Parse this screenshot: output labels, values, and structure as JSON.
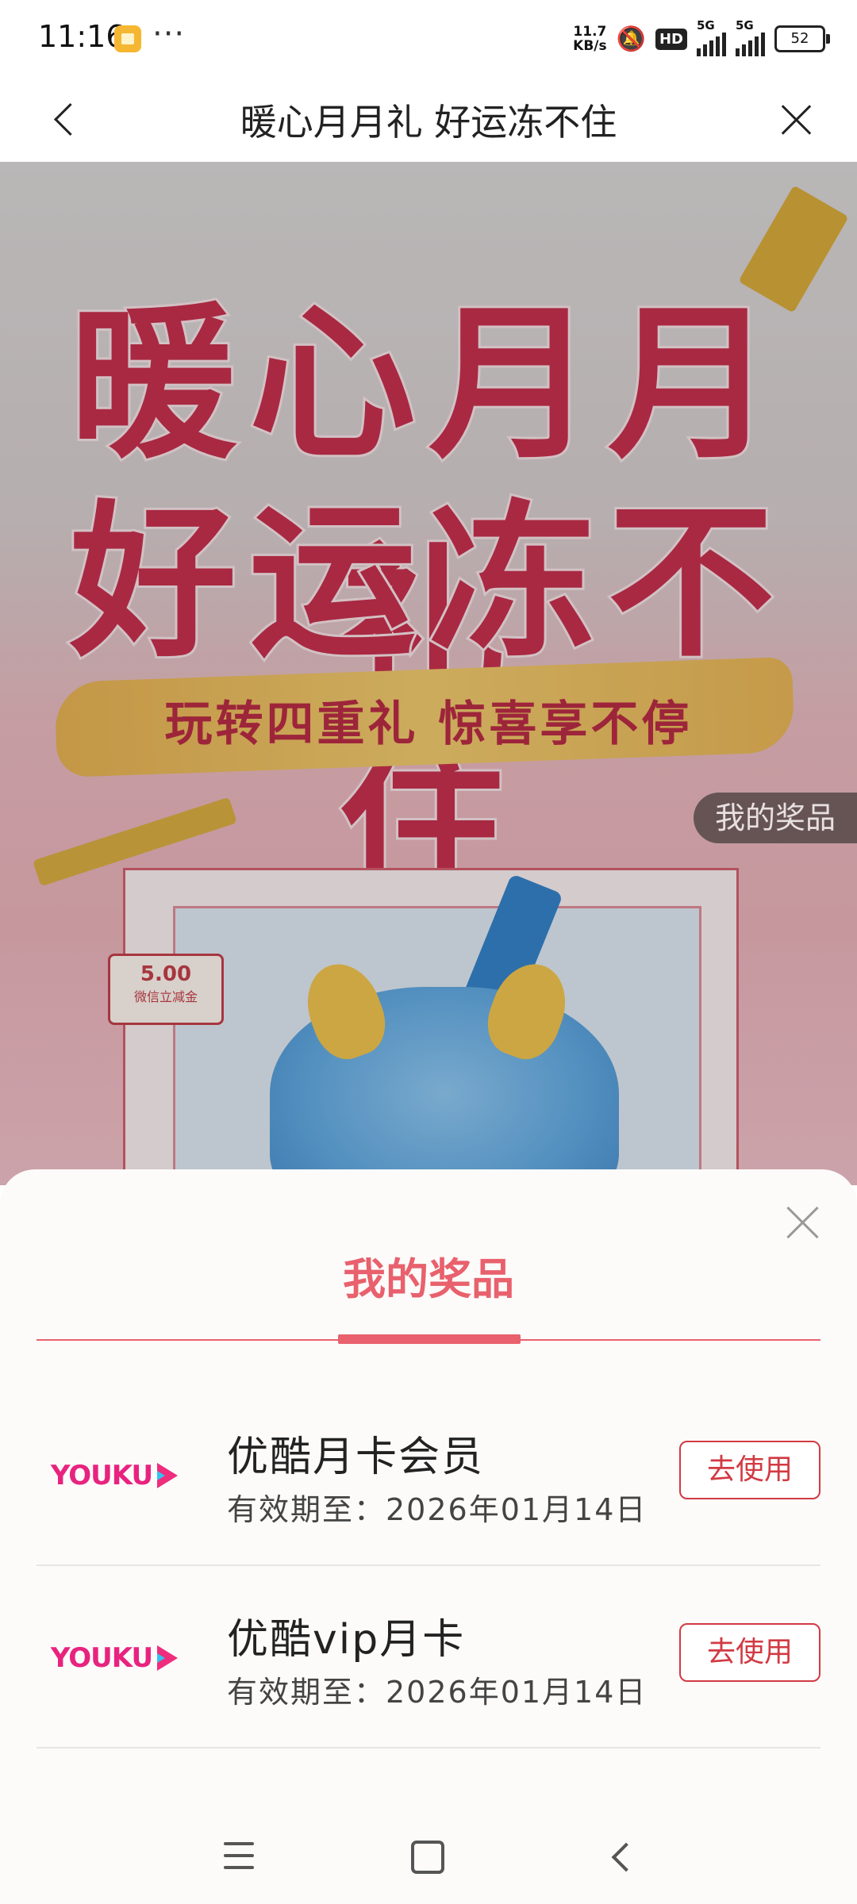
{
  "status_bar": {
    "time": "11:16",
    "more": "···",
    "net_speed_value": "11.7",
    "net_speed_unit": "KB/s",
    "hd_label": "HD",
    "sim1_label": "5G",
    "sim2_label": "5G",
    "battery": "52"
  },
  "navbar": {
    "title": "暖心月月礼 好运冻不住"
  },
  "banner": {
    "title_line1": "暖心月月礼",
    "title_line2": "好运冻不住",
    "subtitle": "玩转四重礼 惊喜享不停",
    "my_prizes_pill": "我的奖品",
    "coupon_value": "5.00",
    "coupon_label": "微信立减金"
  },
  "sheet": {
    "title": "我的奖品",
    "items": [
      {
        "logo_text": "YOUKU",
        "name": "优酷月卡会员",
        "expiry": "有效期至：2026年01月14日",
        "button": "去使用"
      },
      {
        "logo_text": "YOUKU",
        "name": "优酷vip月卡",
        "expiry": "有效期至：2026年01月14日",
        "button": "去使用"
      }
    ]
  },
  "colors": {
    "accent": "#e8616d",
    "button_red": "#d23a43",
    "youku_pink": "#e8237f",
    "youku_blue": "#33c2f0"
  },
  "icons": {
    "back": "chevron-left-icon",
    "close": "close-icon",
    "sheet_close": "close-icon",
    "nav_menu": "menu-icon",
    "nav_home": "home-icon",
    "nav_back": "back-icon"
  }
}
